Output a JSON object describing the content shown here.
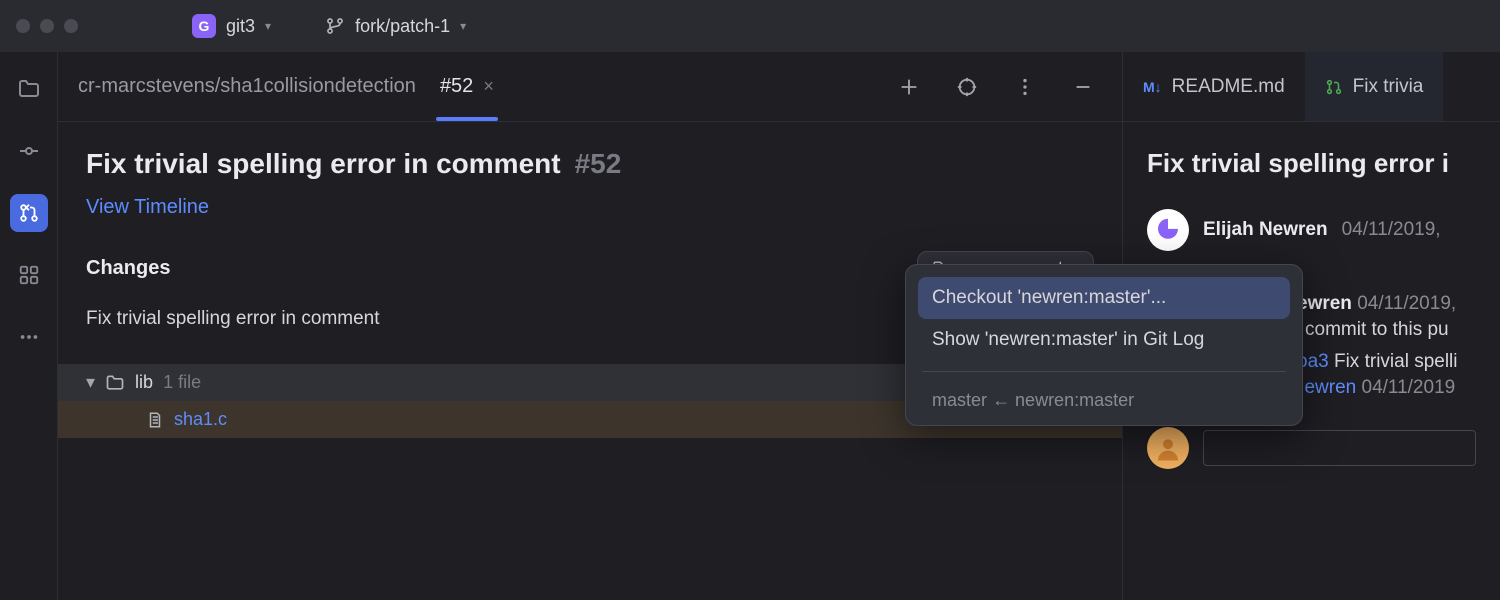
{
  "titlebar": {
    "project_badge": "G",
    "project_name": "git3",
    "branch_name": "fork/patch-1"
  },
  "tabs": {
    "breadcrumb": "cr-marcstevens/sha1collisiondetection",
    "active_tab": "#52"
  },
  "pr": {
    "title": "Fix trivial spelling error in comment",
    "number": "#52",
    "timeline_link": "View Timeline",
    "changes_label": "Changes",
    "tag": "newren:master",
    "commit_message": "Fix trivial spelling error in comment",
    "tree": {
      "folder": "lib",
      "file_count": "1 file",
      "file": "sha1.c"
    }
  },
  "popup": {
    "checkout": "Checkout 'newren:master'...",
    "show_log": "Show 'newren:master' in Git Log",
    "foot_target": "master",
    "foot_source": "newren:master"
  },
  "right": {
    "tab_readme": "README.md",
    "tab_pr": "Fix trivia",
    "title": "Fix trivial spelling error i",
    "author": "Elijah Newren",
    "date": "04/11/2019,",
    "line2_name": "ewren",
    "line2_date": "04/11/2019,",
    "line3": "commit to this pu",
    "commit_hash": "oa3",
    "commit_msg": "Fix trivial spelli",
    "commit_author": "Elijah Newren",
    "commit_date": "04/11/2019"
  }
}
